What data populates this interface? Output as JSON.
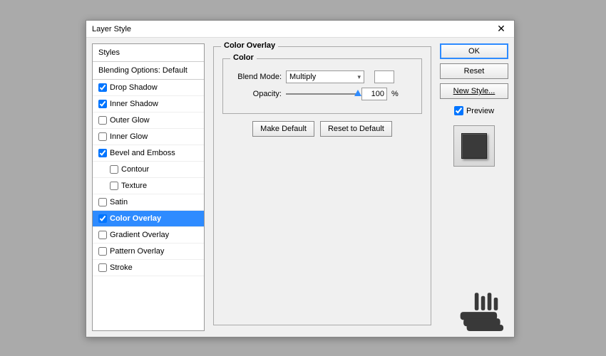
{
  "dialog": {
    "title": "Layer Style"
  },
  "styles_panel": {
    "header": "Styles",
    "blending": "Blending Options: Default",
    "items": [
      {
        "label": "Drop Shadow",
        "checked": true,
        "indent": false
      },
      {
        "label": "Inner Shadow",
        "checked": true,
        "indent": false
      },
      {
        "label": "Outer Glow",
        "checked": false,
        "indent": false
      },
      {
        "label": "Inner Glow",
        "checked": false,
        "indent": false
      },
      {
        "label": "Bevel and Emboss",
        "checked": true,
        "indent": false
      },
      {
        "label": "Contour",
        "checked": false,
        "indent": true
      },
      {
        "label": "Texture",
        "checked": false,
        "indent": true
      },
      {
        "label": "Satin",
        "checked": false,
        "indent": false
      },
      {
        "label": "Color Overlay",
        "checked": true,
        "indent": false,
        "selected": true
      },
      {
        "label": "Gradient Overlay",
        "checked": false,
        "indent": false
      },
      {
        "label": "Pattern Overlay",
        "checked": false,
        "indent": false
      },
      {
        "label": "Stroke",
        "checked": false,
        "indent": false
      }
    ]
  },
  "main": {
    "group_title": "Color Overlay",
    "color_group": "Color",
    "blend_mode_label": "Blend Mode:",
    "blend_mode_value": "Multiply",
    "opacity_label": "Opacity:",
    "opacity_value": "100",
    "opacity_unit": "%",
    "make_default": "Make Default",
    "reset_default": "Reset to Default"
  },
  "right": {
    "ok": "OK",
    "reset": "Reset",
    "new_style": "New Style...",
    "preview": "Preview",
    "preview_checked": true
  }
}
